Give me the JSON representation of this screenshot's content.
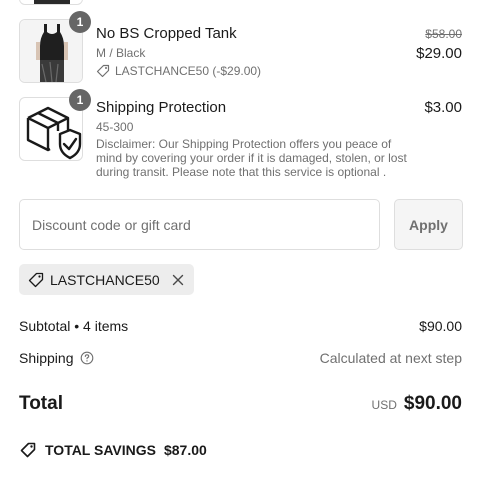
{
  "items": [
    {
      "title": "No BS Cropped Tank",
      "variant": "M / Black",
      "discount_label": "LASTCHANCE50 (-$29.00)",
      "quantity": "1",
      "original_price": "$58.00",
      "price": "$29.00",
      "image_icon": "tank-top-image"
    },
    {
      "title": "Shipping Protection",
      "variant": "45-300",
      "disclaimer": "Disclaimer: Our Shipping Protection offers you peace of mind by covering your order if it is damaged, stolen, or lost during transit. Please note that this service is optional .",
      "quantity": "1",
      "price": "$3.00",
      "image_icon": "shield-package-icon"
    }
  ],
  "discount": {
    "placeholder": "Discount code or gift card",
    "value": "",
    "apply_label": "Apply"
  },
  "applied_code": {
    "code": "LASTCHANCE50",
    "icon": "tag-icon",
    "remove_icon": "close-icon"
  },
  "summary": {
    "subtotal_label": "Subtotal • 4 items",
    "subtotal_value": "$90.00",
    "shipping_label": "Shipping",
    "shipping_value": "Calculated at next step",
    "total_label": "Total",
    "currency": "USD",
    "total_value": "$90.00",
    "savings_label": "TOTAL SAVINGS",
    "savings_value": "$87.00"
  },
  "colors": {
    "text": "#1a1a1a",
    "muted": "#707070",
    "badge": "#666666",
    "border": "#dedede",
    "chip_bg": "#ededed"
  }
}
